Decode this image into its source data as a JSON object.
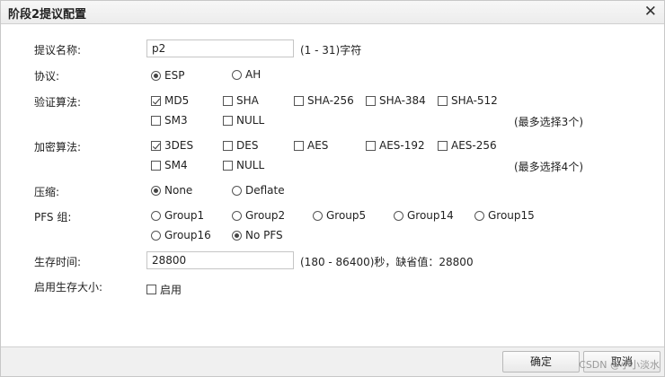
{
  "window": {
    "title": "阶段2提议配置",
    "close_glyph": "✕"
  },
  "name_field": {
    "label": "提议名称:",
    "value": "p2",
    "hint": "(1 - 31)字符"
  },
  "protocol": {
    "label": "协议:",
    "options": [
      {
        "label": "ESP",
        "selected": true
      },
      {
        "label": "AH",
        "selected": false
      }
    ]
  },
  "auth": {
    "label": "验证算法:",
    "options": [
      {
        "label": "MD5",
        "checked": true
      },
      {
        "label": "SHA",
        "checked": false
      },
      {
        "label": "SHA-256",
        "checked": false
      },
      {
        "label": "SHA-384",
        "checked": false
      },
      {
        "label": "SHA-512",
        "checked": false
      },
      {
        "label": "SM3",
        "checked": false
      },
      {
        "label": "NULL",
        "checked": false
      }
    ],
    "hint": "(最多选择3个)"
  },
  "encrypt": {
    "label": "加密算法:",
    "options": [
      {
        "label": "3DES",
        "checked": true
      },
      {
        "label": "DES",
        "checked": false
      },
      {
        "label": "AES",
        "checked": false
      },
      {
        "label": "AES-192",
        "checked": false
      },
      {
        "label": "AES-256",
        "checked": false
      },
      {
        "label": "SM4",
        "checked": false
      },
      {
        "label": "NULL",
        "checked": false
      }
    ],
    "hint": "(最多选择4个)"
  },
  "compress": {
    "label": "压缩:",
    "options": [
      {
        "label": "None",
        "selected": true
      },
      {
        "label": "Deflate",
        "selected": false
      }
    ]
  },
  "pfs": {
    "label": "PFS 组:",
    "options": [
      {
        "label": "Group1",
        "selected": false
      },
      {
        "label": "Group2",
        "selected": false
      },
      {
        "label": "Group5",
        "selected": false
      },
      {
        "label": "Group14",
        "selected": false
      },
      {
        "label": "Group15",
        "selected": false
      },
      {
        "label": "Group16",
        "selected": false
      },
      {
        "label": "No PFS",
        "selected": true
      }
    ]
  },
  "lifetime": {
    "label": "生存时间:",
    "value": "28800",
    "hint": "(180 - 86400)秒，缺省值：28800"
  },
  "lifesize": {
    "label": "启用生存大小:",
    "checkbox_label": "启用",
    "checked": false
  },
  "footer": {
    "ok_label": "确定",
    "cancel_label": "取消"
  },
  "watermark": "CSDN @小小淡水"
}
